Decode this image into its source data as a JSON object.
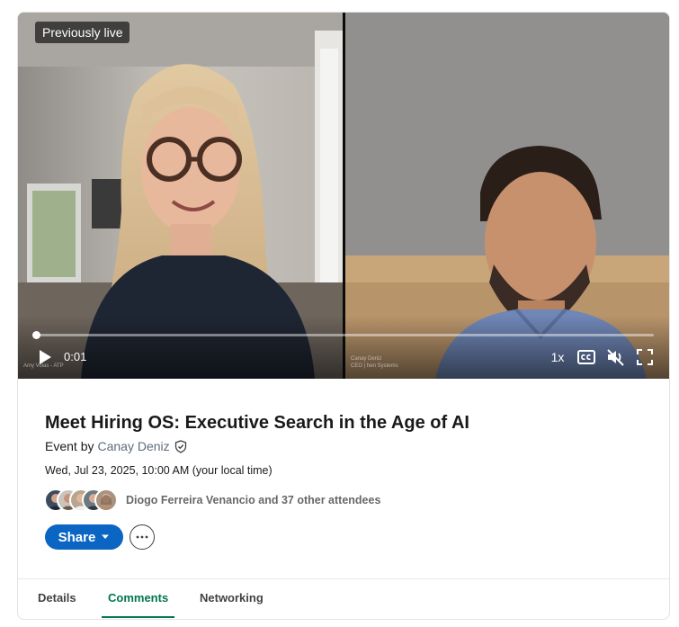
{
  "video": {
    "badge": "Previously live",
    "current_time": "0:01",
    "progress_fraction": 0.002,
    "speed": "1x",
    "left_watermark": "Amy Volas - ATP",
    "right_watermark_1": "Canay Deniz",
    "right_watermark_2": "CEO | hen Systems"
  },
  "event": {
    "title": "Meet Hiring OS: Executive Search in the Age of AI",
    "organizer_prefix": "Event by",
    "organizer_name": "Canay Deniz",
    "datetime": "Wed, Jul 23, 2025, 10:00 AM (your local time)",
    "attendees_text": "Diogo Ferreira Venancio and 37 other attendees"
  },
  "actions": {
    "share_label": "Share",
    "more_label": "···"
  },
  "tabs": [
    {
      "label": "Details"
    },
    {
      "label": "Comments"
    },
    {
      "label": "Networking"
    }
  ],
  "active_tab": "Comments",
  "colors": {
    "brand_blue": "#0a66c2",
    "active_tab_green": "#01754f"
  }
}
